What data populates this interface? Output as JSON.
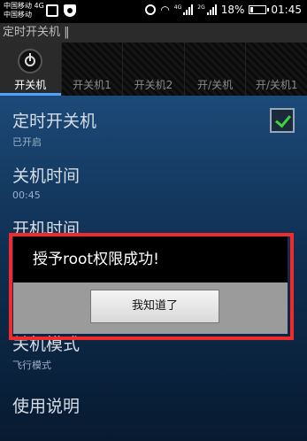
{
  "status_bar": {
    "carrier_line1": "中国移动 4G",
    "carrier_line2": "中国移动",
    "net_tag_1": "4G",
    "net_tag_2": "2G",
    "battery": "18%",
    "time": "01:45"
  },
  "app": {
    "title": "定时开关机 ‖"
  },
  "tabs": [
    {
      "label": "开关机",
      "active": true
    },
    {
      "label": "开关机1"
    },
    {
      "label": "开关机2"
    },
    {
      "label": "开/关机"
    },
    {
      "label": "开/关机1"
    }
  ],
  "settings": [
    {
      "title": "定时开关机",
      "subtitle": "已开启"
    },
    {
      "title": "关机时间",
      "subtitle": "00:45"
    },
    {
      "title": "开机时间",
      "subtitle": ""
    },
    {
      "title": "关机模式",
      "subtitle": "飞行模式"
    },
    {
      "title": "使用说明",
      "subtitle": ""
    }
  ],
  "dialog": {
    "message": "授予root权限成功!",
    "button": "我知道了"
  },
  "colors": {
    "accent": "#4fa3ff",
    "highlight": "#ef2b2b",
    "check": "#3fd13f"
  }
}
